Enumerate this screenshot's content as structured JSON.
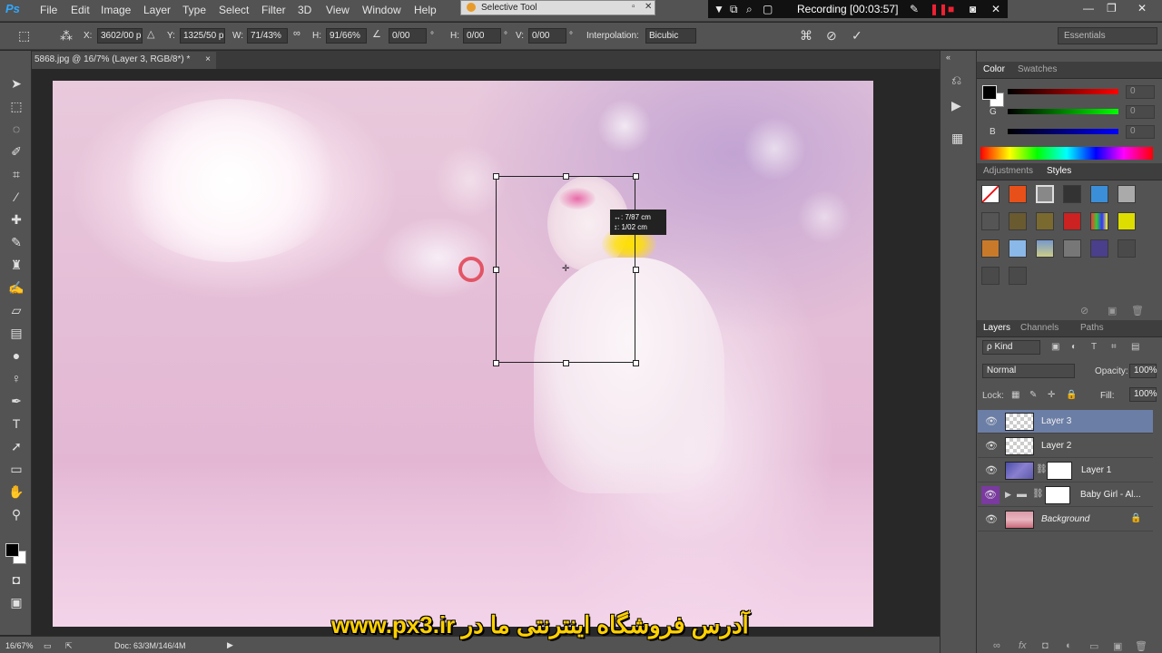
{
  "app": {
    "logo": "Ps"
  },
  "menubar": {
    "items": [
      "File",
      "Edit",
      "Image",
      "Layer",
      "Type",
      "Select",
      "Filter",
      "3D",
      "View",
      "Window",
      "Help"
    ]
  },
  "selective_tool": {
    "title": "Selective Tool"
  },
  "recording": {
    "label": "Recording [00:03:57]"
  },
  "options": {
    "x_label": "X:",
    "x_value": "3602/00 p",
    "y_label": "Y:",
    "y_value": "1325/50 p",
    "w_label": "W:",
    "w_value": "71/43%",
    "h_label": "H:",
    "h_value": "91/66%",
    "angle_value": "0/00",
    "hskew_label": "H:",
    "hskew_value": "0/00",
    "vskew_label": "V:",
    "vskew_value": "0/00",
    "degree": "°",
    "interp_label": "Interpolation:",
    "interp_value": "Bicubic",
    "workspace": "Essentials"
  },
  "document": {
    "tab_title": "5868.jpg @ 16/7% (Layer 3, RGB/8*) *",
    "close": "×"
  },
  "canvas": {
    "measure_w": "↔: 7/87 cm",
    "measure_h": "↕: 1/02 cm",
    "watermark": "آدرس فروشگاه اینترنتی ما در www.px3.ir"
  },
  "status": {
    "zoom": "16/67%",
    "doc": "Doc: 63/3M/146/4M"
  },
  "color_panel": {
    "tabs": [
      "Color",
      "Swatches"
    ],
    "r_label": "R",
    "g_label": "G",
    "b_label": "B",
    "r_value": "0",
    "g_value": "0",
    "b_value": "0"
  },
  "styles_panel": {
    "tabs": [
      "Adjustments",
      "Styles"
    ]
  },
  "layers_panel": {
    "tabs": [
      "Layers",
      "Channels",
      "Paths"
    ],
    "kind": "ρ Kind",
    "blend_mode": "Normal",
    "opacity_label": "Opacity:",
    "opacity_value": "100%",
    "lock_label": "Lock:",
    "fill_label": "Fill:",
    "fill_value": "100%",
    "layers": [
      {
        "name": "Layer 3",
        "selected": true
      },
      {
        "name": "Layer 2",
        "selected": false
      },
      {
        "name": "Layer 1",
        "selected": false
      },
      {
        "name": "Baby Girl - Al...",
        "selected": false
      },
      {
        "name": "Background",
        "selected": false
      }
    ]
  },
  "colors": {
    "accent": "#31a8ff",
    "selected_layer": "#6b7ea6",
    "watermark": "#ffd000"
  }
}
